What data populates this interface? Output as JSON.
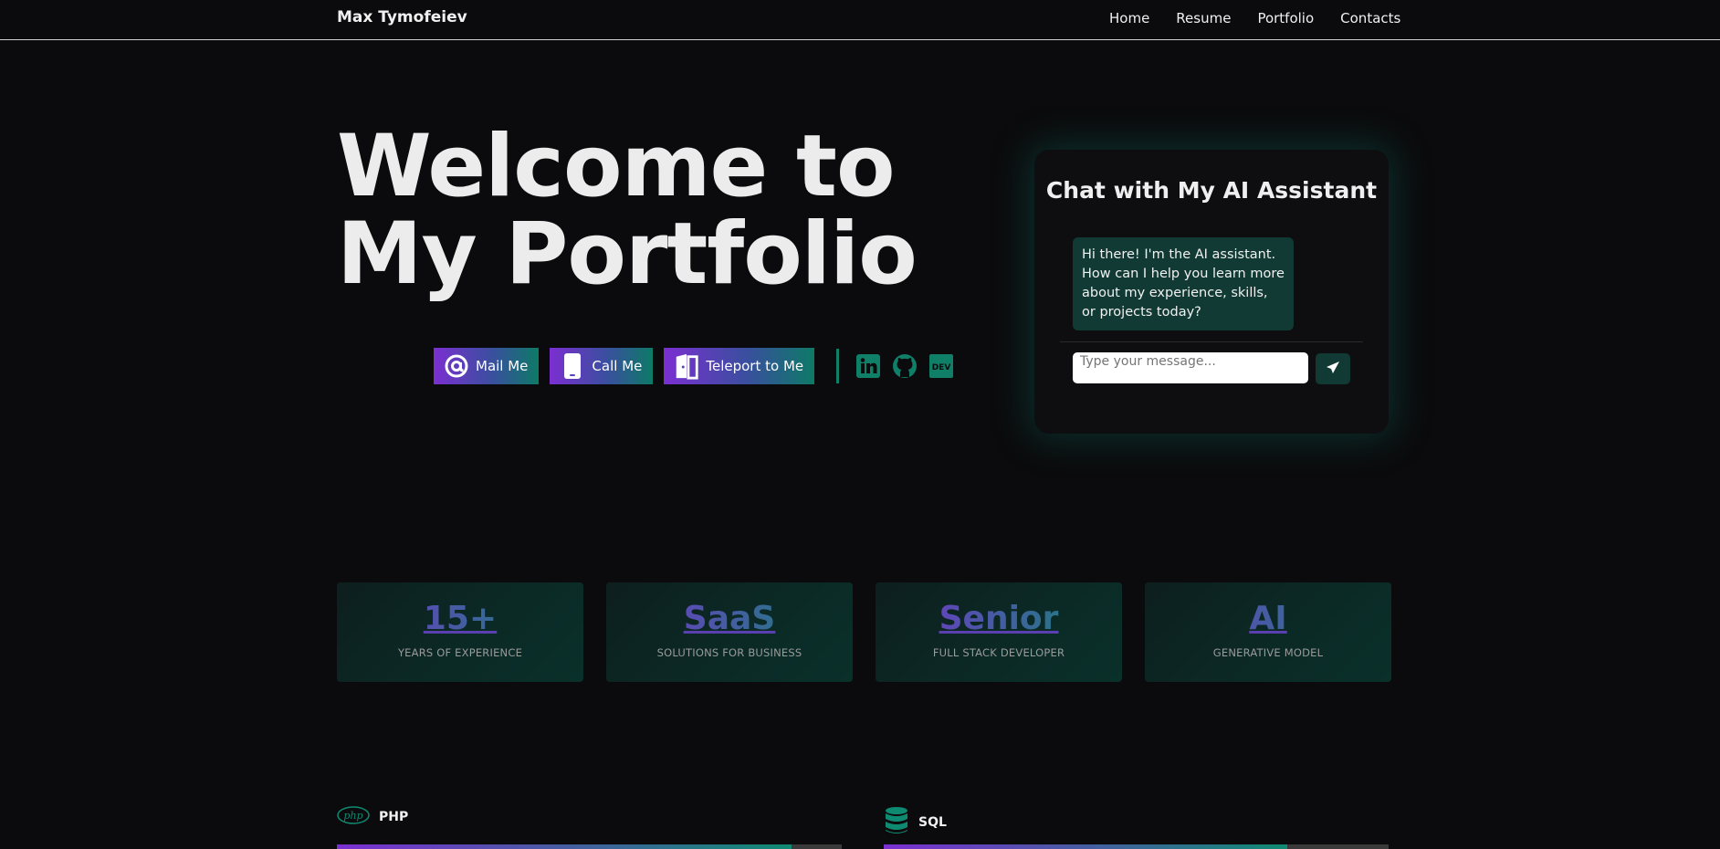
{
  "header": {
    "brand": "Max Tymofeiev",
    "links": [
      "Home",
      "Resume",
      "Portfolio",
      "Contacts"
    ]
  },
  "hero": {
    "title": "Welcome to My Portfolio",
    "buttons": {
      "mail": "Mail Me",
      "call": "Call Me",
      "teleport": "Teleport to Me"
    },
    "social_icons": [
      "linkedin-icon",
      "github-icon",
      "dev-icon"
    ]
  },
  "chat": {
    "title": "Chat with My AI Assistant",
    "greeting": "Hi there! I'm the AI assistant. How can I help you learn more about my experience, skills, or projects today?",
    "input_placeholder": "Type your message..."
  },
  "stats": [
    {
      "value": "15+",
      "label": "YEARS OF EXPERIENCE"
    },
    {
      "value": "SaaS",
      "label": "SOLUTIONS FOR BUSINESS"
    },
    {
      "value": "Senior",
      "label": "FULL STACK DEVELOPER"
    },
    {
      "value": "AI",
      "label": "GENERATIVE MODEL"
    }
  ],
  "skills": [
    {
      "name": "PHP",
      "level": 0.9
    },
    {
      "name": "SQL",
      "level": 0.8
    }
  ],
  "colors": {
    "background": "#0b0b0d",
    "accent_purple": "#7b2fd1",
    "accent_teal": "#0f8a72",
    "chat_bubble": "#113a34"
  }
}
